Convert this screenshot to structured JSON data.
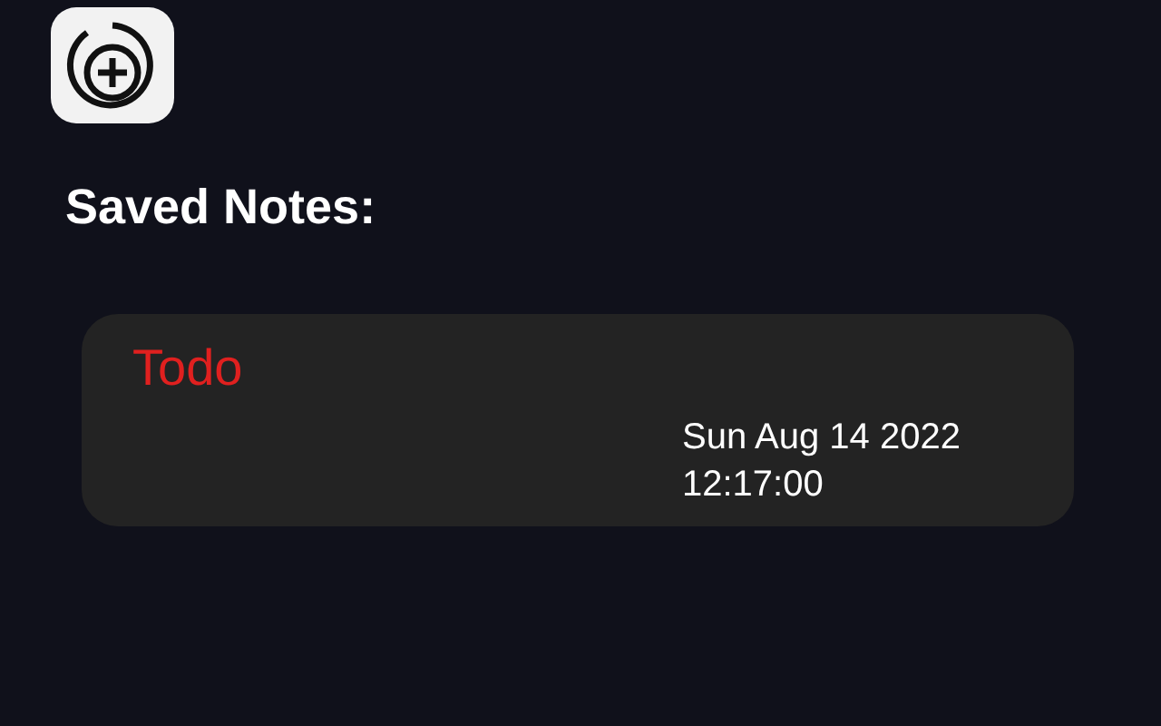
{
  "heading": "Saved Notes:",
  "notes": [
    {
      "title": "Todo",
      "date": "Sun Aug 14 2022 12:17:00"
    }
  ]
}
